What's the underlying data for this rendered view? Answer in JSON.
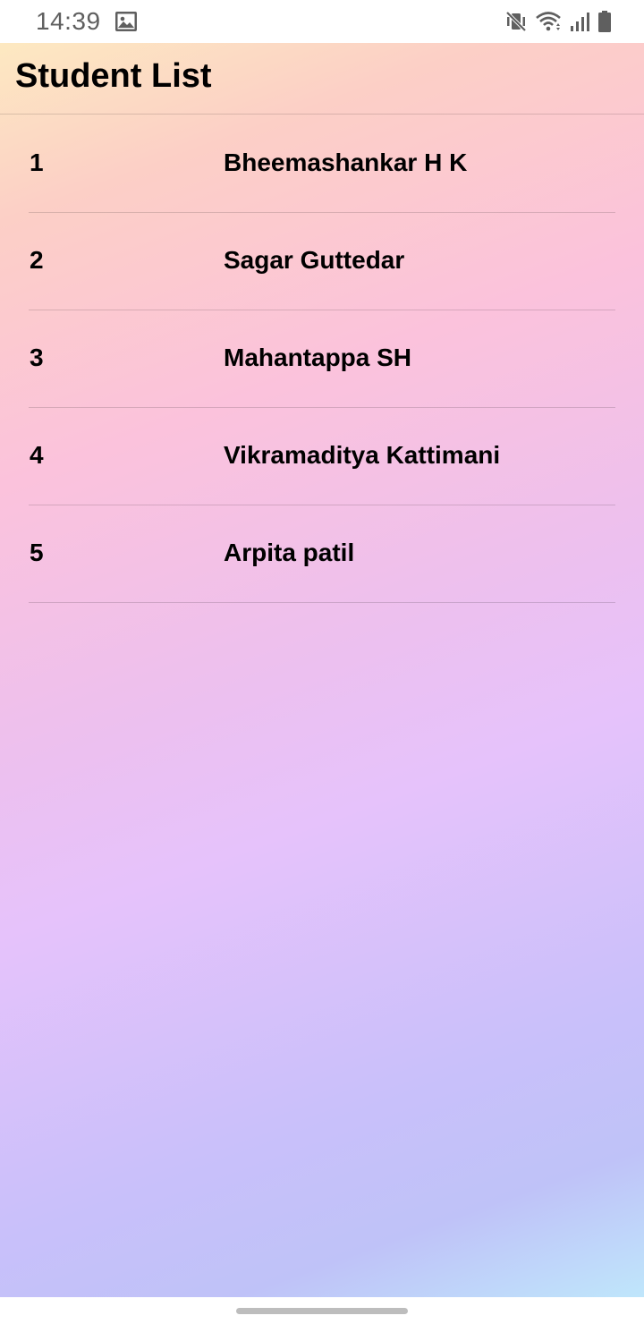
{
  "status_bar": {
    "time": "14:39",
    "icons": [
      "image-icon",
      "vibrate-mute-icon",
      "wifi-icon",
      "signal-icon",
      "battery-icon"
    ]
  },
  "app_bar": {
    "title": "Student List"
  },
  "students": [
    {
      "number": "1",
      "name": "Bheemashankar H K"
    },
    {
      "number": "2",
      "name": "Sagar Guttedar"
    },
    {
      "number": "3",
      "name": "Mahantappa SH"
    },
    {
      "number": "4",
      "name": "Vikramaditya Kattimani"
    },
    {
      "number": "5",
      "name": "Arpita patil"
    }
  ],
  "colors": {
    "gradient_top": "#fde9c1",
    "gradient_mid_pink": "#fbc2dc",
    "gradient_lavender": "#e6c2fb",
    "gradient_bottom": "#bfe6fb",
    "text": "#000000"
  }
}
